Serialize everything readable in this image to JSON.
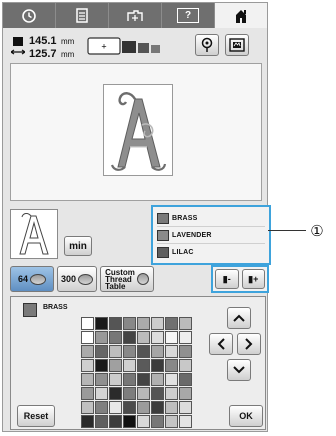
{
  "tabs": [
    {
      "icon": "clock-icon"
    },
    {
      "icon": "document-icon"
    },
    {
      "icon": "machine-settings-icon"
    },
    {
      "icon": "help-icon",
      "label": "?"
    },
    {
      "icon": "home-icon"
    }
  ],
  "size": {
    "width": "145.1",
    "height": "125.7",
    "unit": "mm"
  },
  "color_list": {
    "items": [
      {
        "name": "BRASS",
        "color": "#7a7a7a"
      },
      {
        "name": "LAVENDER",
        "color": "#8a8a8a"
      },
      {
        "name": "LILAC",
        "color": "#5e5e5e"
      }
    ]
  },
  "callout": {
    "number": "①"
  },
  "buttons": {
    "min": "min",
    "brand_64": "64",
    "brand_300": "300",
    "custom_thread_table_line1": "Custom",
    "custom_thread_table_line2": "Thread",
    "custom_thread_table_line3": "Table",
    "move_up": "▮-",
    "move_down": "▮+",
    "reset": "Reset",
    "ok": "OK"
  },
  "current_color": {
    "name": "BRASS",
    "color": "#7a7a7a"
  },
  "palette_cells": [
    "#ffffff",
    "#1a1a1a",
    "#555555",
    "#888888",
    "#aaaaaa",
    "#cccccc",
    "#707070",
    "#bbbbbb",
    "#ffffff",
    "#999999",
    "#777777",
    "#444444",
    "#bbbbbb",
    "#dddddd",
    "#f5f5f5",
    "#eeeeee",
    "#aaaaaa",
    "#666666",
    "#bdbdbd",
    "#888888",
    "#555555",
    "#a6a6a6",
    "#d9d9d9",
    "#909090",
    "#cfcfcf",
    "#1a1a1a",
    "#a0a0a0",
    "#d0d0d0",
    "#5a5a5a",
    "#3a3a3a",
    "#888888",
    "#c8c8c8",
    "#b5b5b5",
    "#909090",
    "#cccccc",
    "#777777",
    "#444444",
    "#b0b0b0",
    "#e0e0e0",
    "#6a6a6a",
    "#9a9a9a",
    "#d5d5d5",
    "#2b2b2b",
    "#7d7d7d",
    "#b8b8b8",
    "#555555",
    "#cfcfcf",
    "#a8a8a8",
    "#c0c0c0",
    "#808080",
    "#e8e8e8",
    "#4c4c4c",
    "#9c9c9c",
    "#3c3c3c",
    "#bebebe",
    "#dcdcdc",
    "#2a2a2a",
    "#5f5f5f",
    "#3d3d3d",
    "#111111",
    "#d8d8d8",
    "#777777",
    "#c4c4c4",
    "#e4e4e4"
  ]
}
